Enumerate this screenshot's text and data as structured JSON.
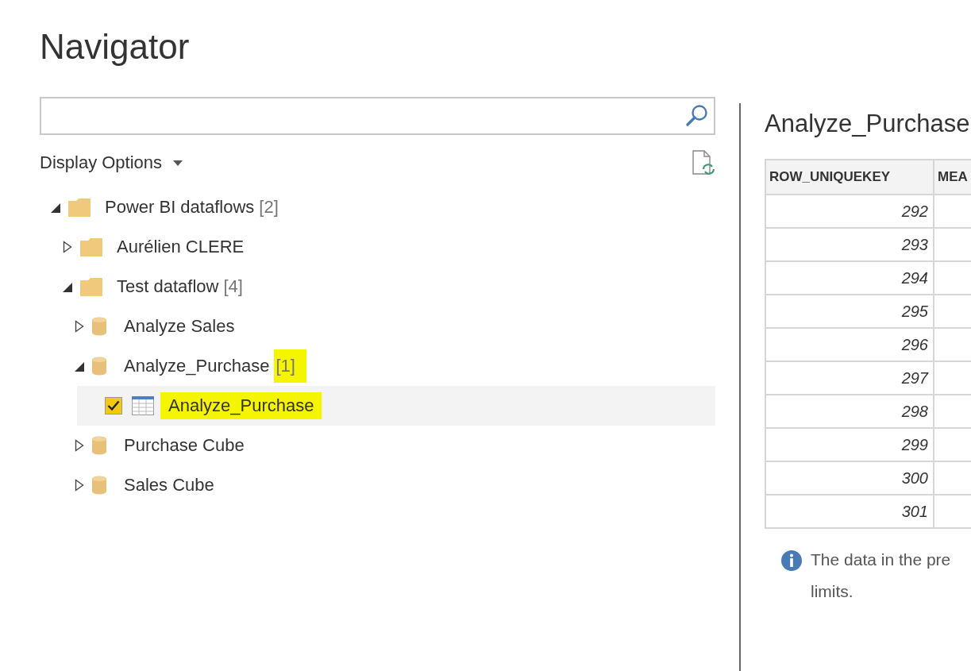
{
  "window": {
    "title": "Navigator"
  },
  "display_options": {
    "label": "Display Options"
  },
  "tree": [
    {
      "kind": "folder",
      "label": "Power BI dataflows",
      "count": "[2]",
      "expanded": true,
      "children": [
        {
          "kind": "folder",
          "label": "Aurélien CLERE",
          "expanded": false
        },
        {
          "kind": "folder",
          "label": "Test dataflow",
          "count": "[4]",
          "expanded": true,
          "children": [
            {
              "kind": "dataflow",
              "label": "Analyze Sales",
              "expanded": false
            },
            {
              "kind": "dataflow",
              "label": "Analyze_Purchase",
              "count": "[1]",
              "count_highlighted": true,
              "expanded": true,
              "children": [
                {
                  "kind": "table",
                  "label": "Analyze_Purchase",
                  "label_highlighted": true,
                  "checked": true,
                  "selected": true
                }
              ]
            },
            {
              "kind": "dataflow",
              "label": "Purchase Cube",
              "expanded": false
            },
            {
              "kind": "dataflow",
              "label": "Sales Cube",
              "expanded": false
            }
          ]
        }
      ]
    }
  ],
  "preview": {
    "title": "Analyze_Purchase",
    "columns": [
      "ROW_UNIQUEKEY",
      "MEA"
    ],
    "rows": [
      [
        "292",
        ""
      ],
      [
        "293",
        ""
      ],
      [
        "294",
        ""
      ],
      [
        "295",
        ""
      ],
      [
        "296",
        ""
      ],
      [
        "297",
        ""
      ],
      [
        "298",
        ""
      ],
      [
        "299",
        ""
      ],
      [
        "300",
        ""
      ],
      [
        "301",
        ""
      ]
    ],
    "notice_lines": [
      "The data in the pre",
      "limits."
    ]
  }
}
